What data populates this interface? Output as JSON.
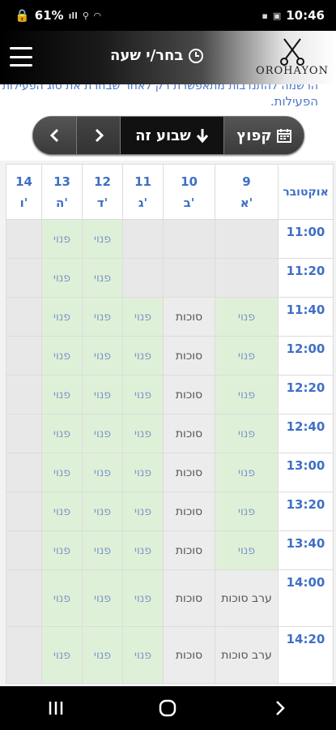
{
  "status_bar": {
    "battery": "61%",
    "time": "10:46"
  },
  "header": {
    "title": "בחר/י שעה",
    "logo_text": "OROHAYON"
  },
  "notice": {
    "line1": "הרשמה להתנדבות מתאפשרת רק לאחר שבחרת את סוג הפעילות",
    "line2": "הפעילות."
  },
  "nav": {
    "jump_label": "קפוץ",
    "this_week_label": "שבוע זה"
  },
  "table": {
    "month_label": "אוקטובר",
    "days": [
      {
        "num": "9",
        "letter": "א'"
      },
      {
        "num": "10",
        "letter": "ב'"
      },
      {
        "num": "11",
        "letter": "ג'"
      },
      {
        "num": "12",
        "letter": "ד'"
      },
      {
        "num": "13",
        "letter": "ה'"
      },
      {
        "num": "14",
        "letter": "ו'"
      }
    ],
    "rows": [
      {
        "time": "11:00",
        "cells": [
          "",
          "",
          "",
          "פנוי",
          "פנוי",
          ""
        ]
      },
      {
        "time": "11:20",
        "cells": [
          "",
          "",
          "",
          "פנוי",
          "פנוי",
          ""
        ]
      },
      {
        "time": "11:40",
        "cells": [
          "פנוי",
          "סוכות",
          "פנוי",
          "פנוי",
          "פנוי",
          ""
        ]
      },
      {
        "time": "12:00",
        "cells": [
          "פנוי",
          "סוכות",
          "פנוי",
          "פנוי",
          "פנוי",
          ""
        ]
      },
      {
        "time": "12:20",
        "cells": [
          "פנוי",
          "סוכות",
          "פנוי",
          "פנוי",
          "פנוי",
          ""
        ]
      },
      {
        "time": "12:40",
        "cells": [
          "פנוי",
          "סוכות",
          "פנוי",
          "פנוי",
          "פנוי",
          ""
        ]
      },
      {
        "time": "13:00",
        "cells": [
          "פנוי",
          "סוכות",
          "פנוי",
          "פנוי",
          "פנוי",
          ""
        ]
      },
      {
        "time": "13:20",
        "cells": [
          "פנוי",
          "סוכות",
          "פנוי",
          "פנוי",
          "פנוי",
          ""
        ]
      },
      {
        "time": "13:40",
        "cells": [
          "פנוי",
          "סוכות",
          "פנוי",
          "פנוי",
          "פנוי",
          ""
        ]
      },
      {
        "time": "14:00",
        "cells": [
          "ערב סוכות",
          "סוכות",
          "פנוי",
          "פנוי",
          "פנוי",
          ""
        ]
      },
      {
        "time": "14:20",
        "cells": [
          "ערב סוכות",
          "סוכות",
          "פנוי",
          "פנוי",
          "פנוי",
          ""
        ]
      }
    ]
  },
  "colors": {
    "accent_blue": "#3f6fc6",
    "free_green": "#dff0d8",
    "holiday_gray": "#ececec"
  }
}
